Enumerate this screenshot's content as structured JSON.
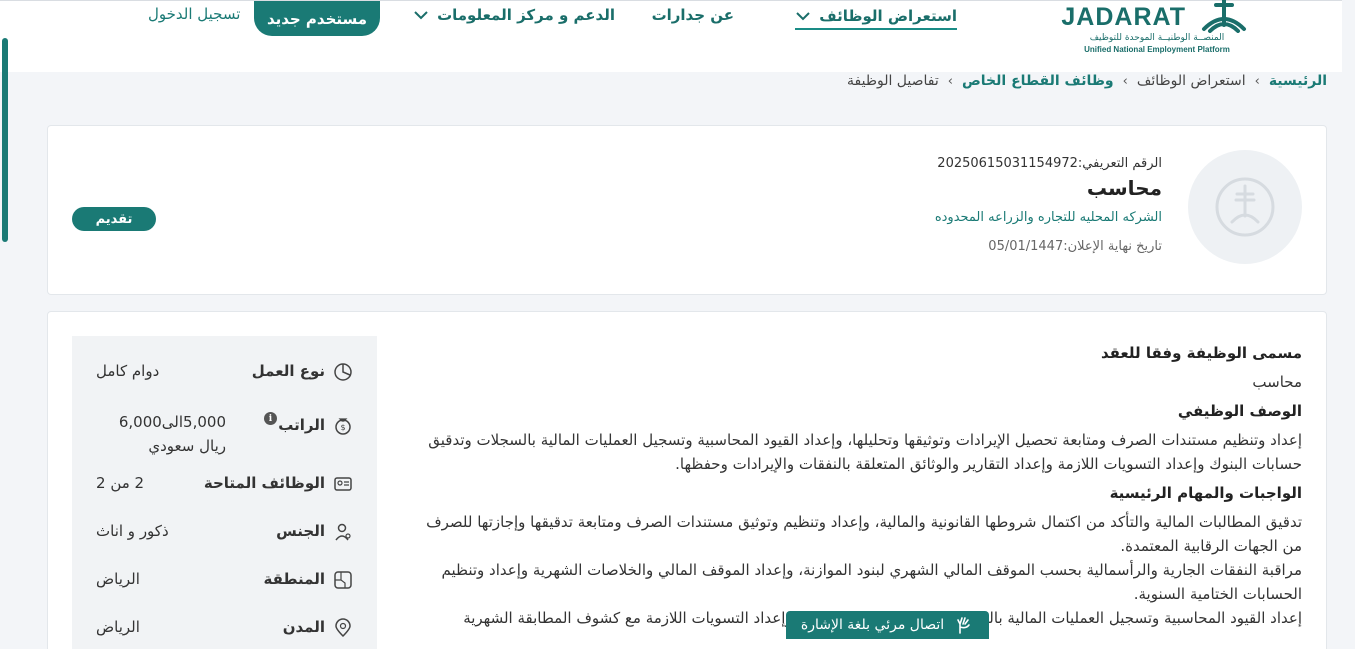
{
  "header": {
    "logo": {
      "wordmark": "JADARAT",
      "arabic_name": "المنصــة الوطنيــة الموحدة للتوظيف",
      "english_name": "Unified National Employment Platform"
    },
    "nav": {
      "browse_jobs": "استعراض الوظائف",
      "about": "عن جدارات",
      "support": "الدعم و مركز المعلومات"
    },
    "new_user": "مستخدم جديد",
    "login": "تسجيل الدخول"
  },
  "breadcrumb": {
    "home": "الرئيسية",
    "browse": "استعراض الوظائف",
    "private_jobs": "وظائف القطاع الخاص",
    "current": "تفاصيل الوظيفة"
  },
  "job": {
    "id_label": "الرقم التعريفي:",
    "id_value": "20250615031154972",
    "title": "محاسب",
    "company": "الشركه المحليه للتجاره والزراعه المحدوده",
    "deadline_label": "تاريخ نهاية الإعلان:",
    "deadline_value": "05/01/1447",
    "apply": "تقديم"
  },
  "details": {
    "contract_title_heading": "مسمى الوظيفة وفقا للعقد",
    "contract_title": "محاسب",
    "description_heading": "الوصف الوظيفي",
    "description": "إعداد وتنظيم مستندات الصرف ومتابعة تحصيل الإيرادات وتوثيقها وتحليلها، وإعداد القيود المحاسبية وتسجيل العمليات المالية بالسجلات وتدقيق حسابات البنوك وإعداد التسويات اللازمة وإعداد التقارير والوثائق المتعلقة بالنفقات والإيرادات وحفظها.",
    "duties_heading": "الواجبات والمهام الرئيسية",
    "duty_1": "تدقيق المطالبات المالية والتأكد من اكتمال شروطها القانونية والمالية، وإعداد وتنظيم وتوثيق مستندات الصرف ومتابعة تدقيقها وإجازتها للصرف من الجهات الرقابية المعتمدة.",
    "duty_2": "مراقبة النفقات الجارية والرأسمالية بحسب الموقف المالي الشهري لبنود الموازنة، وإعداد الموقف المالي والخلاصات الشهرية وإعداد وتنظيم الحسابات الختامية السنوية.",
    "duty_3": "إعداد القيود المحاسبية وتسجيل العمليات المالية بالسجلات وتدقيق حسابات البنوك وإعداد التسويات اللازمة مع كشوف المطابقة الشهرية"
  },
  "summary": {
    "work_type_label": "نوع العمل",
    "work_type": "دوام كامل",
    "salary_label": "الراتب",
    "salary_info_icon": "i",
    "salary": "5,000الى6,000 ريال سعودي",
    "openings_label": "الوظائف المتاحة",
    "openings": "2 من 2",
    "gender_label": "الجنس",
    "gender": "ذكور و اناث",
    "region_label": "المنطقة",
    "region": "الرياض",
    "city_label": "المدن",
    "city": "الرياض"
  },
  "sign_language": "اتصال مرئي بلغة الإشارة",
  "colors": {
    "brand": "#1a7a75",
    "background": "#f3f5f8",
    "panel": "#f1f3f5"
  }
}
